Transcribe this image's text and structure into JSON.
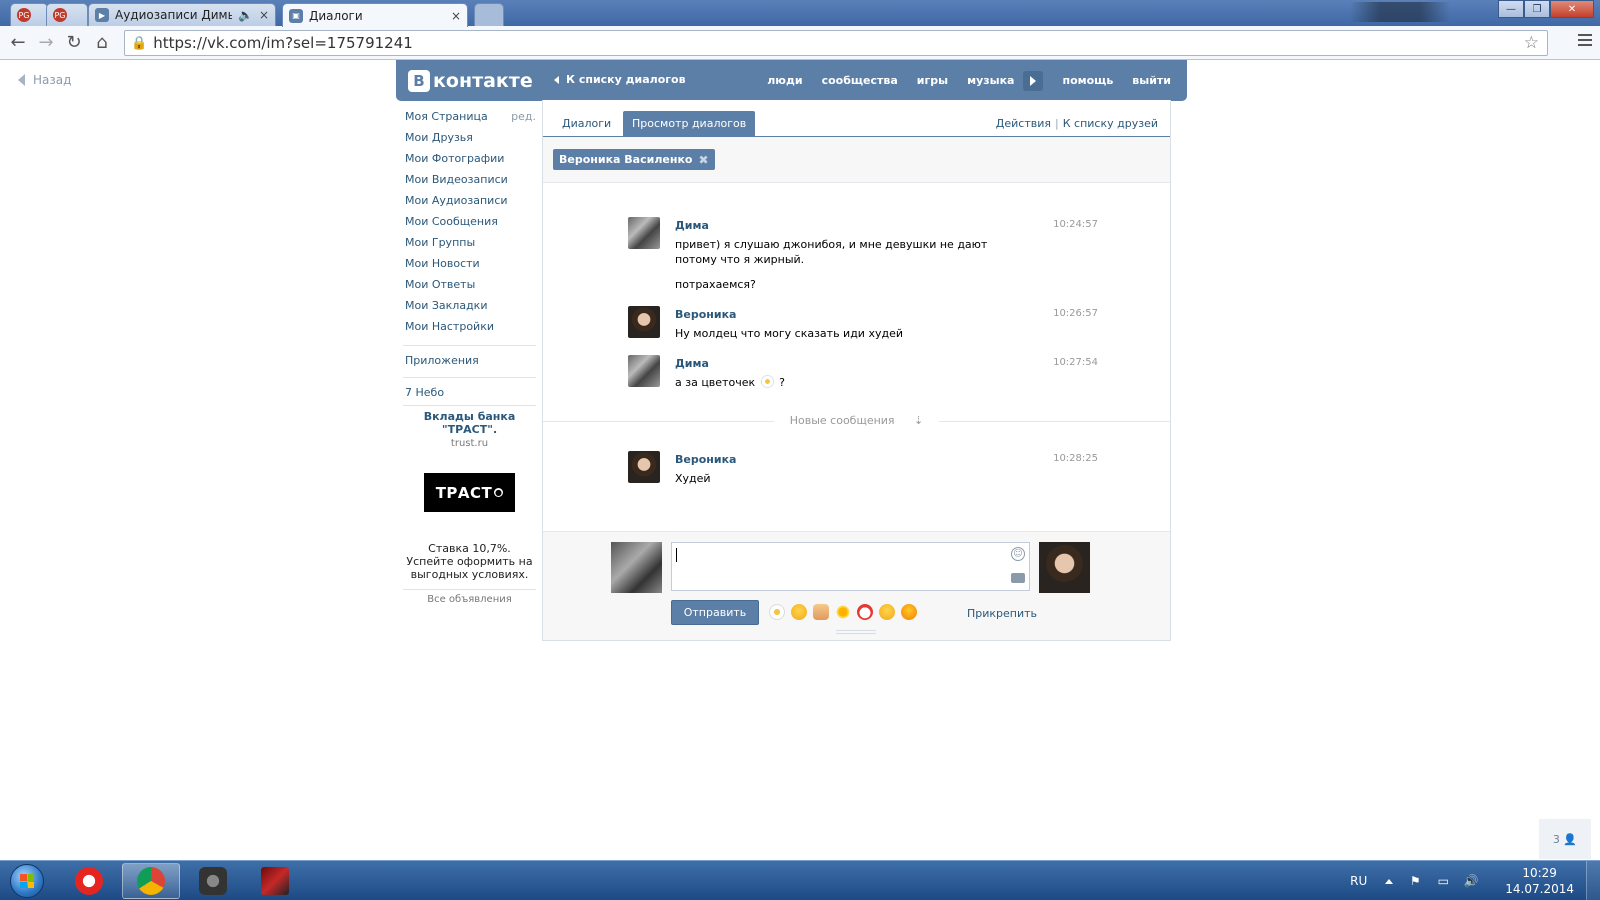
{
  "browser": {
    "tabs": [
      {
        "title": "",
        "icon": "red-circle-favicon"
      },
      {
        "title": "",
        "icon": "red-circle-favicon"
      },
      {
        "title": "Аудиозаписи Димы П",
        "icon": "vk-audio-favicon",
        "audio": "speaker-icon",
        "close": "×"
      },
      {
        "title": "Диалоги",
        "icon": "vk-favicon",
        "close": "×"
      }
    ],
    "url": "https://vk.com/im?sel=175791241",
    "window_buttons": {
      "minimize": "—",
      "maximize": "❐",
      "close": "✕"
    }
  },
  "page": {
    "back_label": "Назад",
    "header": {
      "logo": "контакте",
      "logo_letter": "B",
      "back_to_dialogs": "К списку диалогов",
      "nav": [
        "люди",
        "сообщества",
        "игры",
        "музыка",
        "помощь",
        "выйти"
      ]
    },
    "left_menu": {
      "items": [
        "Моя Страница",
        "Мои Друзья",
        "Мои Фотографии",
        "Мои Видеозаписи",
        "Мои Аудиозаписи",
        "Мои Сообщения",
        "Мои Группы",
        "Мои Новости",
        "Мои Ответы",
        "Мои Закладки",
        "Мои Настройки"
      ],
      "edit_label": "ред.",
      "apps": "Приложения",
      "app1": "7 Небо"
    },
    "ad": {
      "title": "Вклады банка \"ТРАСТ\".",
      "domain": "trust.ru",
      "logo": "ТРАСТ",
      "text": "Ставка 10,7%. Успейте оформить на выгодных условиях.",
      "all_ads": "Все объявления"
    },
    "dialogs": {
      "tabs": [
        "Диалоги",
        "Просмотр диалогов"
      ],
      "active_tab": 1,
      "actions": "Действия",
      "to_friends": "К списку друзей",
      "peer_chip": "Вероника Василенко",
      "messages": [
        {
          "author": "Дима",
          "time": "10:24:57",
          "text": "привет) я слушаю джонибоя, и мне девушки не дают потому что я жирный.",
          "text2": "потрахаемся?"
        },
        {
          "author": "Вероника",
          "time": "10:26:57",
          "text": "Ну молдец что могу сказать иди худей"
        },
        {
          "author": "Дима",
          "time": "10:27:54",
          "text_before": "а за цветочек",
          "text_after": "?"
        },
        {
          "author": "Вероника",
          "time": "10:28:25",
          "text": "Худей"
        }
      ],
      "new_messages_label": "Новые сообщения",
      "send_label": "Отправить",
      "attach_label": "Прикрепить",
      "emoji_icons": [
        "flower-emoji",
        "laughing-emoji",
        "thumbs-up-emoji",
        "sun-emoji",
        "chicken-emoji",
        "tongue-emoji",
        "heart-eyes-emoji"
      ]
    },
    "side_counter": "3"
  },
  "taskbar": {
    "lang": "RU",
    "time": "10:29",
    "date": "14.07.2014",
    "apps": [
      "yandex-browser-icon",
      "chrome-icon",
      "world-of-tanks-icon",
      "game-icon"
    ]
  },
  "colors": {
    "vk_blue": "#5b7fa6",
    "link": "#2b587a",
    "taskbar": "#1d4a85"
  }
}
